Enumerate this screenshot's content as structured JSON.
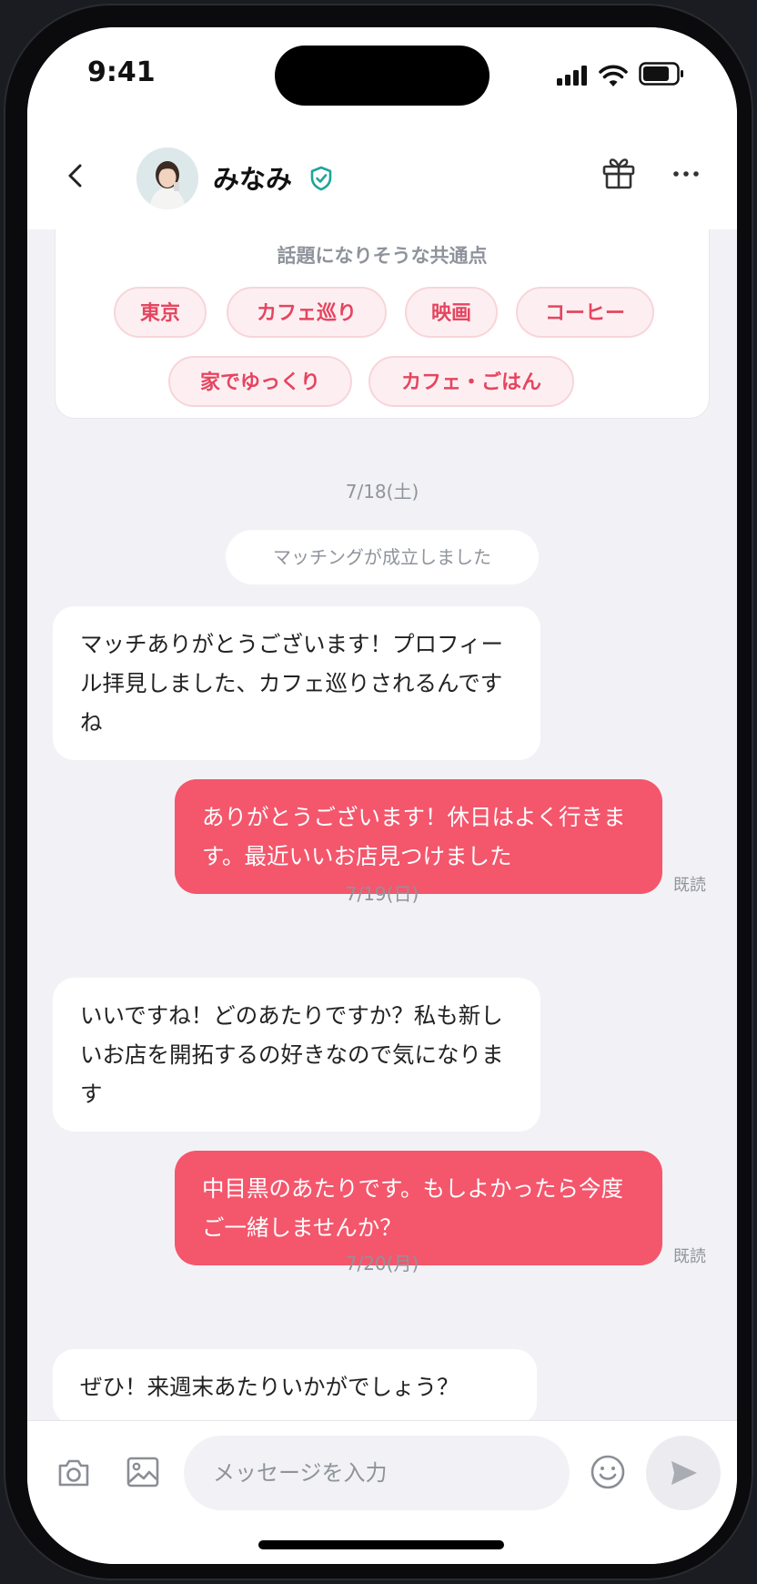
{
  "status_bar": {
    "time": "9:41"
  },
  "header": {
    "name": "みなみ"
  },
  "topics": {
    "title": "話題になりそうな共通点",
    "tags": [
      "東京",
      "カフェ巡り",
      "映画",
      "コーヒー",
      "家でゆっくり",
      "カフェ・ごはん"
    ]
  },
  "messages": [
    {
      "type": "date",
      "text": "7/18(土)"
    },
    {
      "type": "system",
      "text": "マッチングが成立しました"
    },
    {
      "type": "in",
      "text": "マッチありがとうございます！プロフィール拝見しました、カフェ巡りされるんですね"
    },
    {
      "type": "out",
      "text": "ありがとうございます！休日はよく行きます。最近いいお店見つけました",
      "status": "既読"
    },
    {
      "type": "date",
      "text": "7/19(日)"
    },
    {
      "type": "in",
      "text": "いいですね！どのあたりですか？私も新しいお店を開拓するの好きなので気になります"
    },
    {
      "type": "out",
      "text": "中目黒のあたりです。もしよかったら今度ご一緒しませんか？",
      "status": "既読"
    },
    {
      "type": "date",
      "text": "7/20(月)"
    },
    {
      "type": "in",
      "text": "ぜひ！来週末あたりいかがでしょう？"
    }
  ],
  "input": {
    "placeholder": "メッセージを入力",
    "value": ""
  },
  "colors": {
    "accent": "#f4566c",
    "chip_text": "#e54560",
    "chip_bg": "#fdeff1",
    "verified": "#1fa59a",
    "muted": "#8f939b"
  }
}
